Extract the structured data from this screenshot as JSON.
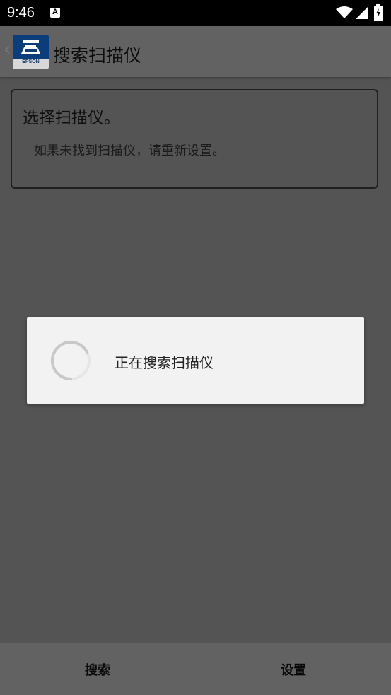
{
  "status_bar": {
    "time": "9:46"
  },
  "app_bar": {
    "title": "搜索扫描仪",
    "logo_text": "EPSON"
  },
  "info_card": {
    "heading": "选择扫描仪。",
    "message": "如果未找到扫描仪，请重新设置。"
  },
  "progress_dialog": {
    "message": "正在搜索扫描仪"
  },
  "bottom_bar": {
    "search_label": "搜索",
    "settings_label": "设置"
  }
}
